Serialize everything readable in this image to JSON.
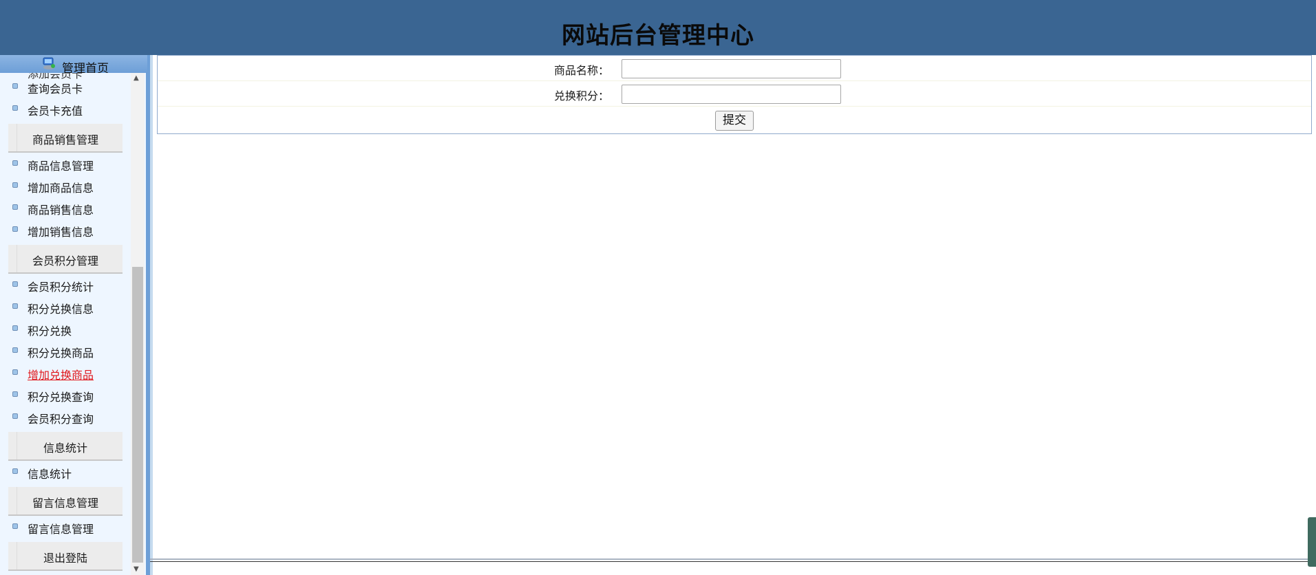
{
  "header": {
    "title": "网站后台管理中心"
  },
  "sidebar": {
    "home_label": "管理首页",
    "peek_text": "添加会员卡",
    "menu": [
      {
        "type": "item",
        "label": "查询会员卡"
      },
      {
        "type": "item",
        "label": "会员卡充值"
      },
      {
        "type": "section",
        "label": "商品销售管理"
      },
      {
        "type": "item",
        "label": "商品信息管理"
      },
      {
        "type": "item",
        "label": "增加商品信息"
      },
      {
        "type": "item",
        "label": "商品销售信息"
      },
      {
        "type": "item",
        "label": "增加销售信息"
      },
      {
        "type": "section",
        "label": "会员积分管理"
      },
      {
        "type": "item",
        "label": "会员积分统计"
      },
      {
        "type": "item",
        "label": "积分兑换信息"
      },
      {
        "type": "item",
        "label": "积分兑换"
      },
      {
        "type": "item",
        "label": "积分兑换商品"
      },
      {
        "type": "item",
        "label": "增加兑换商品",
        "active": true
      },
      {
        "type": "item",
        "label": "积分兑换查询"
      },
      {
        "type": "item",
        "label": "会员积分查询"
      },
      {
        "type": "section",
        "label": "信息统计"
      },
      {
        "type": "item",
        "label": "信息统计"
      },
      {
        "type": "section",
        "label": "留言信息管理"
      },
      {
        "type": "item",
        "label": "留言信息管理"
      },
      {
        "type": "section",
        "label": "退出登陆"
      }
    ]
  },
  "form": {
    "product_name_label": "商品名称：",
    "product_name_value": "",
    "points_label": "兑换积分：",
    "points_value": "",
    "submit_label": "提交"
  }
}
